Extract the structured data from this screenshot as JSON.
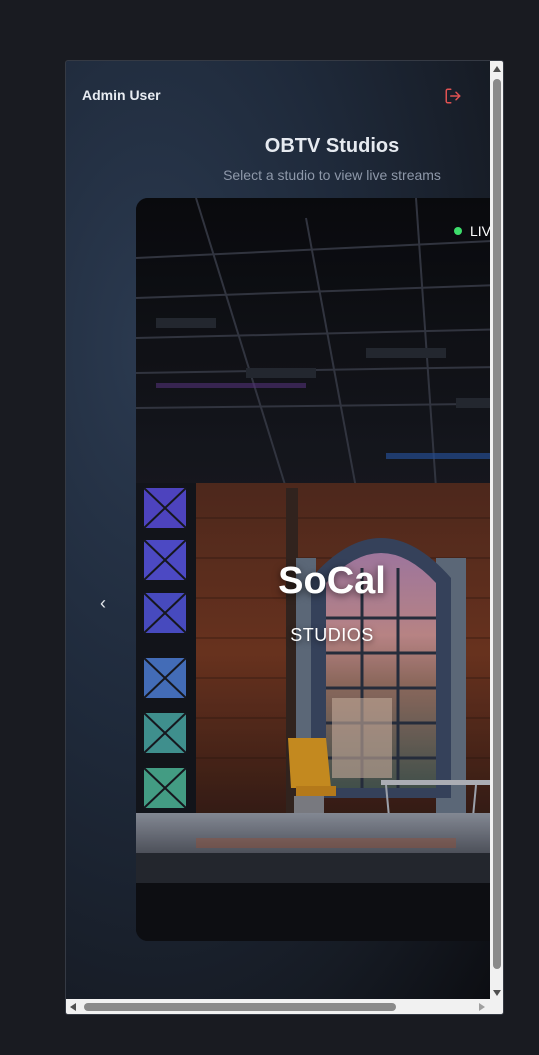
{
  "header": {
    "user_name": "Admin User",
    "logout_icon": "logout-icon",
    "logout_color": "#e05252"
  },
  "page": {
    "title": "OBTV Studios",
    "subtitle": "Select a studio to view live streams"
  },
  "carousel": {
    "prev_icon": "chevron-left-icon",
    "prev_glyph": "‹",
    "studio": {
      "name": "SoCal",
      "tagline": "STUDIOS",
      "live_label": "LIV",
      "live_color": "#3ddc6b"
    }
  }
}
